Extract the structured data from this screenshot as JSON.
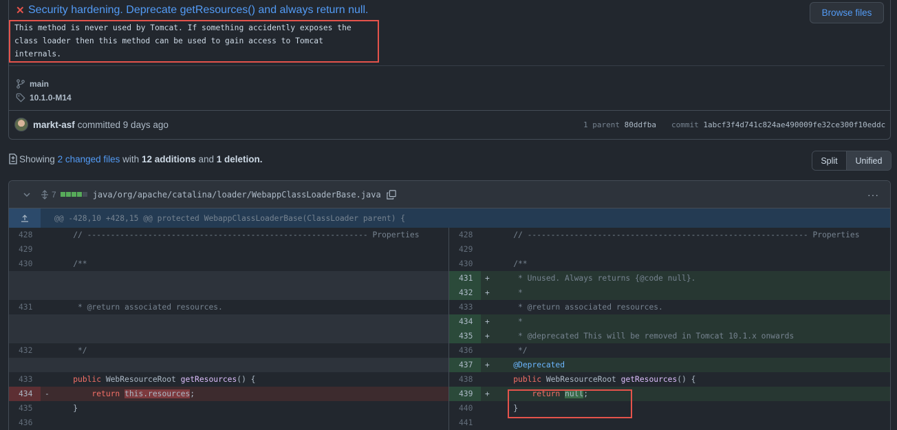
{
  "commit": {
    "title": "Security hardening. Deprecate getResources() and always return null.",
    "description": "This method is never used by Tomcat. If something accidently exposes the\nclass loader then this method can be used to gain access to Tomcat\ninternals.",
    "browse_label": "Browse files",
    "branch": "main",
    "tag": "10.1.0-M14",
    "author": "markt-asf",
    "committed_text": "committed 9 days ago",
    "parent_label": "1 parent",
    "parent_sha": "80ddfba",
    "commit_label": "commit",
    "commit_sha": "1abcf3f4d741c824ae490009fe32ce300f10eddc"
  },
  "stats": {
    "showing": "Showing",
    "changed_files": "2 changed files",
    "with": "with",
    "additions": "12 additions",
    "and": "and",
    "deletions": "1 deletion."
  },
  "view_toggle": {
    "split": "Split",
    "unified": "Unified"
  },
  "file": {
    "count": "7",
    "path": "java/org/apache/catalina/loader/WebappClassLoaderBase.java",
    "more": "···",
    "hunk": "@@ -428,10 +428,15 @@ protected WebappClassLoaderBase(ClassLoader parent) {"
  },
  "diff_rows": [
    {
      "l_ln": "428",
      "l_sgn": "",
      "l_code": "    // ------------------------------------------------------------ Properties",
      "r_ln": "428",
      "r_sgn": "",
      "r_code": "    // ------------------------------------------------------------ Properties"
    },
    {
      "l_ln": "429",
      "l_sgn": "",
      "l_code": "",
      "r_ln": "429",
      "r_sgn": "",
      "r_code": ""
    },
    {
      "l_ln": "430",
      "l_sgn": "",
      "l_code": "    /**",
      "r_ln": "430",
      "r_sgn": "",
      "r_code": "    /**"
    },
    {
      "l_ln": "",
      "l_sgn": "",
      "l_code": "",
      "r_ln": "431",
      "r_sgn": "+",
      "r_code": "     * Unused. Always returns {@code null}."
    },
    {
      "l_ln": "",
      "l_sgn": "",
      "l_code": "",
      "r_ln": "432",
      "r_sgn": "+",
      "r_code": "     *"
    },
    {
      "l_ln": "431",
      "l_sgn": "",
      "l_code": "     * @return associated resources.",
      "r_ln": "433",
      "r_sgn": "",
      "r_code": "     * @return associated resources."
    },
    {
      "l_ln": "",
      "l_sgn": "",
      "l_code": "",
      "r_ln": "434",
      "r_sgn": "+",
      "r_code": "     *"
    },
    {
      "l_ln": "",
      "l_sgn": "",
      "l_code": "",
      "r_ln": "435",
      "r_sgn": "+",
      "r_code": "     * @deprecated This will be removed in Tomcat 10.1.x onwards"
    },
    {
      "l_ln": "432",
      "l_sgn": "",
      "l_code": "     */",
      "r_ln": "436",
      "r_sgn": "",
      "r_code": "     */"
    },
    {
      "l_ln": "",
      "l_sgn": "",
      "l_code": "",
      "r_ln": "437",
      "r_sgn": "+",
      "r_code": "    @Deprecated"
    },
    {
      "l_ln": "433",
      "l_sgn": "",
      "l_code": "    public WebResourceRoot getResources() {",
      "r_ln": "438",
      "r_sgn": "",
      "r_code": "    public WebResourceRoot getResources() {"
    },
    {
      "l_ln": "434",
      "l_sgn": "-",
      "l_code": "        return this.resources;",
      "r_ln": "439",
      "r_sgn": "+",
      "r_code": "        return null;"
    },
    {
      "l_ln": "435",
      "l_sgn": "",
      "l_code": "    }",
      "r_ln": "440",
      "r_sgn": "",
      "r_code": "    }"
    },
    {
      "l_ln": "436",
      "l_sgn": "",
      "l_code": "",
      "r_ln": "441",
      "r_sgn": "",
      "r_code": ""
    }
  ],
  "colors": {
    "accent": "#539bf5",
    "added": "#57ab5a",
    "deleted": "#e5534b",
    "annotation_box": "#e5534b"
  }
}
